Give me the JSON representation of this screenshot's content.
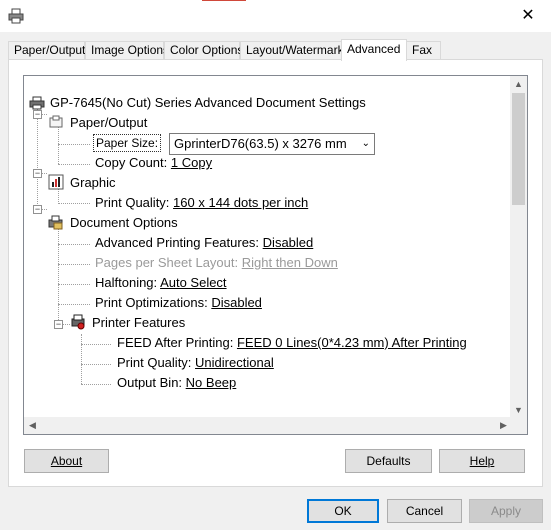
{
  "window": {
    "title_icon": "printer-icon",
    "close_glyph": "✕"
  },
  "tabs": [
    {
      "label": "Paper/Output"
    },
    {
      "label": "Image Options"
    },
    {
      "label": "Color Options"
    },
    {
      "label": "Layout/Watermark"
    },
    {
      "label": "Advanced"
    },
    {
      "label": "Fax"
    }
  ],
  "active_tab": "Advanced",
  "tree": {
    "root": "GP-7645(No Cut) Series Advanced Document Settings",
    "paper_output": {
      "label": "Paper/Output",
      "paper_size_label": "Paper Size:",
      "paper_size_value": "GprinterD76(63.5) x 3276 mm",
      "copy_count_label": "Copy Count:",
      "copy_count_value": "1 Copy"
    },
    "graphic": {
      "label": "Graphic",
      "print_quality_label": "Print Quality:",
      "print_quality_value": "160 x 144 dots per inch"
    },
    "document_options": {
      "label": "Document Options",
      "advanced_features_label": "Advanced Printing Features:",
      "advanced_features_value": "Disabled",
      "pages_per_sheet_label": "Pages per Sheet Layout:",
      "pages_per_sheet_value": "Right then Down",
      "halftoning_label": "Halftoning:",
      "halftoning_value": "Auto Select",
      "print_opt_label": "Print Optimizations:",
      "print_opt_value": "Disabled"
    },
    "printer_features": {
      "label": "Printer Features",
      "feed_label": "FEED After Printing:",
      "feed_value": "FEED 0 Lines(0*4.23 mm) After Printing",
      "quality_label": "Print Quality:",
      "quality_value": "Unidirectional",
      "output_bin_label": "Output Bin:",
      "output_bin_value": "No Beep"
    }
  },
  "buttons": {
    "about": "About",
    "defaults": "Defaults",
    "help": "Help",
    "ok": "OK",
    "cancel": "Cancel",
    "apply": "Apply"
  }
}
